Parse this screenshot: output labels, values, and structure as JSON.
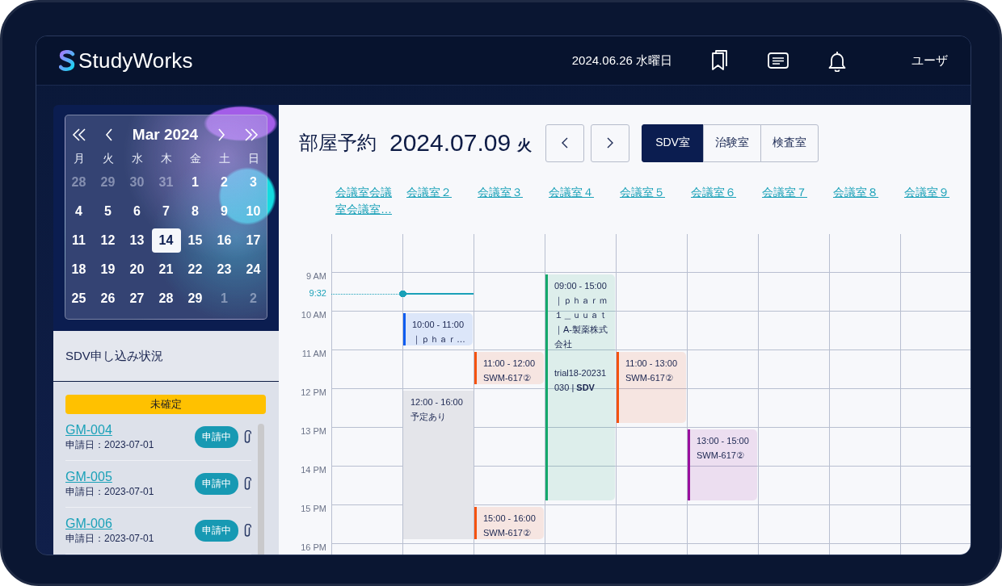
{
  "header": {
    "logo": "StudyWorks",
    "date": "2024.06.26 水曜日",
    "user": "ユーザ"
  },
  "mini_calendar": {
    "title": "Mar 2024",
    "weekdays": [
      "月",
      "火",
      "水",
      "木",
      "金",
      "土",
      "日"
    ],
    "days": [
      {
        "day": "28",
        "other_month": true,
        "selected": false
      },
      {
        "day": "29",
        "other_month": true,
        "selected": false
      },
      {
        "day": "30",
        "other_month": true,
        "selected": false
      },
      {
        "day": "31",
        "other_month": true,
        "selected": false
      },
      {
        "day": "1",
        "other_month": false,
        "selected": false
      },
      {
        "day": "2",
        "other_month": false,
        "selected": false
      },
      {
        "day": "3",
        "other_month": false,
        "selected": false
      },
      {
        "day": "4",
        "other_month": false,
        "selected": false
      },
      {
        "day": "5",
        "other_month": false,
        "selected": false
      },
      {
        "day": "6",
        "other_month": false,
        "selected": false
      },
      {
        "day": "7",
        "other_month": false,
        "selected": false
      },
      {
        "day": "8",
        "other_month": false,
        "selected": false
      },
      {
        "day": "9",
        "other_month": false,
        "selected": false
      },
      {
        "day": "10",
        "other_month": false,
        "selected": false
      },
      {
        "day": "11",
        "other_month": false,
        "selected": false
      },
      {
        "day": "12",
        "other_month": false,
        "selected": false
      },
      {
        "day": "13",
        "other_month": false,
        "selected": false
      },
      {
        "day": "14",
        "other_month": false,
        "selected": true
      },
      {
        "day": "15",
        "other_month": false,
        "selected": false
      },
      {
        "day": "16",
        "other_month": false,
        "selected": false
      },
      {
        "day": "17",
        "other_month": false,
        "selected": false
      },
      {
        "day": "18",
        "other_month": false,
        "selected": false
      },
      {
        "day": "19",
        "other_month": false,
        "selected": false
      },
      {
        "day": "20",
        "other_month": false,
        "selected": false
      },
      {
        "day": "21",
        "other_month": false,
        "selected": false
      },
      {
        "day": "22",
        "other_month": false,
        "selected": false
      },
      {
        "day": "23",
        "other_month": false,
        "selected": false
      },
      {
        "day": "24",
        "other_month": false,
        "selected": false
      },
      {
        "day": "25",
        "other_month": false,
        "selected": false
      },
      {
        "day": "26",
        "other_month": false,
        "selected": false
      },
      {
        "day": "27",
        "other_month": false,
        "selected": false
      },
      {
        "day": "28",
        "other_month": false,
        "selected": false
      },
      {
        "day": "29",
        "other_month": false,
        "selected": false
      },
      {
        "day": "1",
        "other_month": true,
        "selected": false
      },
      {
        "day": "2",
        "other_month": true,
        "selected": false
      }
    ]
  },
  "applications": {
    "title": "SDV申し込み状況",
    "group": "未確定",
    "items": [
      {
        "id": "GM-004",
        "date": "申請日：2023-07-01",
        "status": "申請中"
      },
      {
        "id": "GM-005",
        "date": "申請日：2023-07-01",
        "status": "申請中"
      },
      {
        "id": "GM-006",
        "date": "申請日：2023-07-01",
        "status": "申請中"
      }
    ]
  },
  "booking": {
    "title": "部屋予約",
    "date": "2024.07.09",
    "weekday": "火",
    "tabs": [
      {
        "label": "SDV室",
        "selected": true
      },
      {
        "label": "治験室",
        "selected": false
      },
      {
        "label": "検査室",
        "selected": false
      }
    ],
    "hours": [
      "9 AM",
      "10 AM",
      "11 AM",
      "12 PM",
      "13 PM",
      "14 PM",
      "15 PM",
      "16 PM"
    ],
    "now": {
      "label": "9:32"
    },
    "rooms": [
      {
        "name": "会議室会議室会議室…"
      },
      {
        "name": "会議室２",
        "events": [
          {
            "kind": "booking",
            "color": "#0d5cf0",
            "time": "10:00 - 11:00",
            "title": "｜ｐｈａｒ…"
          },
          {
            "kind": "blocked",
            "time": "12:00 - 16:00",
            "title": "予定あり"
          }
        ]
      },
      {
        "name": "会議室３",
        "events": [
          {
            "kind": "booking",
            "color": "#f5520f",
            "time": "11:00 - 12:00",
            "title": "SWM-617②"
          },
          {
            "kind": "booking",
            "color": "#f5520f",
            "time": "15:00 - 16:00",
            "title": "SWM-617②"
          }
        ]
      },
      {
        "name": "会議室４",
        "events": [
          {
            "kind": "booking",
            "color": "#14a86c",
            "time": "09:00 - 15:00",
            "title": "｜ｐｈａｒｍ１＿ｕｕａｔ｜A-製薬株式会社",
            "note": "trial18-20231030 | **SDV**"
          }
        ]
      },
      {
        "name": "会議室５",
        "events": [
          {
            "kind": "booking",
            "color": "#f5520f",
            "time": "11:00 - 13:00",
            "title": "SWM-617②"
          }
        ]
      },
      {
        "name": "会議室６",
        "events": [
          {
            "kind": "booking",
            "color": "#9a0f9e",
            "time": "13:00 - 15:00",
            "title": "SWM-617②"
          }
        ]
      },
      {
        "name": "会議室７"
      },
      {
        "name": "会議室８"
      },
      {
        "name": "会議室９"
      }
    ]
  }
}
